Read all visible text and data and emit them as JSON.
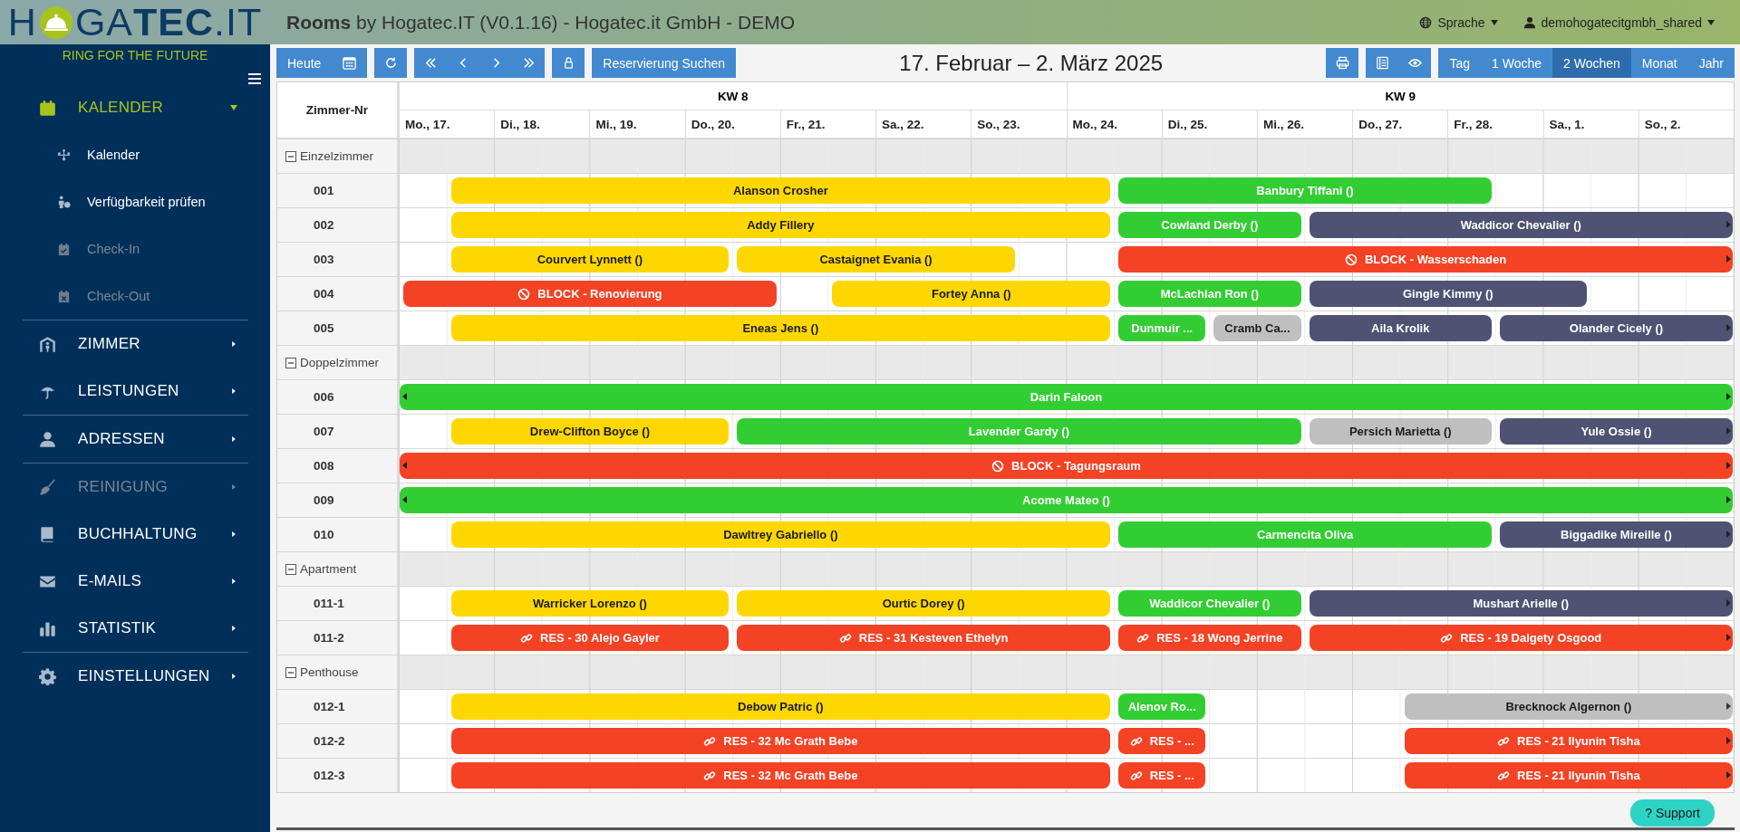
{
  "header": {
    "logo": {
      "letter": "H",
      "text": "GA**TEC**.IT"
    },
    "title": "**Rooms** by Hogatec.IT (V0.1.16) - Hogatec.it GmbH - DEMO",
    "menus": [
      {
        "label": "Sprache"
      },
      {
        "label": "demohogatecitgmbh_shared"
      }
    ]
  },
  "sidebar": {
    "tagline": "RING FOR THE FUTURE",
    "groups": [
      {
        "items": [
          {
            "label": "KALENDER",
            "selected": true,
            "expanded": true,
            "disabled": false,
            "children": [
              {
                "label": "Kalender",
                "disabled": false
              },
              {
                "label": "Verfügbarkeit prüfen",
                "disabled": false
              },
              {
                "label": "Check-In",
                "disabled": true
              },
              {
                "label": "Check-Out",
                "disabled": true
              }
            ]
          }
        ]
      },
      {
        "items": [
          {
            "label": "ZIMMER",
            "selected": false,
            "expanded": false,
            "disabled": false
          },
          {
            "label": "LEISTUNGEN",
            "selected": false,
            "expanded": false,
            "disabled": false
          }
        ]
      },
      {
        "items": [
          {
            "label": "ADRESSEN",
            "selected": false,
            "expanded": false,
            "disabled": false
          }
        ]
      },
      {
        "items": [
          {
            "label": "REINIGUNG",
            "selected": false,
            "expanded": false,
            "disabled": true
          },
          {
            "label": "BUCHHALTUNG",
            "selected": false,
            "expanded": false,
            "disabled": false
          },
          {
            "label": "E-MAILS",
            "selected": false,
            "expanded": false,
            "disabled": false
          },
          {
            "label": "STATISTIK",
            "selected": false,
            "expanded": false,
            "disabled": false
          }
        ]
      },
      {
        "items": [
          {
            "label": "EINSTELLUNGEN",
            "selected": false,
            "expanded": false,
            "disabled": false
          }
        ]
      }
    ]
  },
  "toolbar": {
    "today": "Heute",
    "search": "Reservierung Suchen",
    "range_title": "17. Februar – 2. März 2025",
    "views": [
      {
        "label": "Tag",
        "selected": false
      },
      {
        "label": "1 Woche",
        "selected": false
      },
      {
        "label": "2 Wochen",
        "selected": true
      },
      {
        "label": "Monat",
        "selected": false
      },
      {
        "label": "Jahr",
        "selected": false
      }
    ]
  },
  "grid": {
    "room_header": "Zimmer-Nr",
    "weeks": [
      {
        "label": "KW 8"
      },
      {
        "label": "KW 9"
      }
    ],
    "days": [
      {
        "label": "Mo., 17."
      },
      {
        "label": "Di., 18."
      },
      {
        "label": "Mi., 19."
      },
      {
        "label": "Do., 20."
      },
      {
        "label": "Fr., 21."
      },
      {
        "label": "Sa., 22."
      },
      {
        "label": "So., 23."
      },
      {
        "label": "Mo., 24."
      },
      {
        "label": "Di., 25."
      },
      {
        "label": "Mi., 26."
      },
      {
        "label": "Do., 27."
      },
      {
        "label": "Fr., 28."
      },
      {
        "label": "Sa., 1."
      },
      {
        "label": "So., 2."
      }
    ],
    "groups": [
      {
        "name": "Einzelzimmer",
        "expanded": true,
        "rooms": [
          {
            "number": "001",
            "bookings": [
              {
                "label": "Alanson Crosher",
                "kind": "guest",
                "color": "#ffd700",
                "continues_left": false,
                "continues_right": false
              },
              {
                "label": "Banbury Tiffani ()",
                "kind": "guest",
                "color": "#32cd32",
                "continues_left": false,
                "continues_right": false
              }
            ]
          },
          {
            "number": "002",
            "bookings": [
              {
                "label": "Addy Fillery",
                "kind": "guest",
                "color": "#ffd700",
                "continues_left": false,
                "continues_right": false
              },
              {
                "label": "Cowland Derby ()",
                "kind": "guest",
                "color": "#32cd32",
                "continues_left": false,
                "continues_right": false
              },
              {
                "label": "Waddicor Chevalier ()",
                "kind": "guest",
                "color": "#4f5273",
                "continues_left": false,
                "continues_right": true
              }
            ]
          },
          {
            "number": "003",
            "bookings": [
              {
                "label": "Courvert Lynnett ()",
                "kind": "guest",
                "color": "#ffd700",
                "continues_left": false,
                "continues_right": false
              },
              {
                "label": "Castaignet Evania ()",
                "kind": "guest",
                "color": "#ffd700",
                "continues_left": false,
                "continues_right": false
              },
              {
                "label": "BLOCK - Wasserschaden",
                "kind": "block",
                "color": "#f44225",
                "continues_left": false,
                "continues_right": true
              }
            ]
          },
          {
            "number": "004",
            "bookings": [
              {
                "label": "BLOCK - Renovierung",
                "kind": "block",
                "color": "#f44225",
                "continues_left": false,
                "continues_right": false
              },
              {
                "label": "Fortey Anna ()",
                "kind": "guest",
                "color": "#ffd700",
                "continues_left": false,
                "continues_right": false
              },
              {
                "label": "McLachlan Ron ()",
                "kind": "guest",
                "color": "#32cd32",
                "continues_left": false,
                "continues_right": false
              },
              {
                "label": "Gingle Kimmy ()",
                "kind": "guest",
                "color": "#4f5273",
                "continues_left": false,
                "continues_right": false
              }
            ]
          },
          {
            "number": "005",
            "bookings": [
              {
                "label": "Eneas Jens ()",
                "kind": "guest",
                "color": "#ffd700",
                "continues_left": false,
                "continues_right": false
              },
              {
                "label": "Dunmuir ...",
                "kind": "guest",
                "color": "#32cd32",
                "continues_left": false,
                "continues_right": false
              },
              {
                "label": "Cramb Ca...",
                "kind": "guest",
                "color": "#bfbfbf",
                "continues_left": false,
                "continues_right": false
              },
              {
                "label": "Aila Krolik",
                "kind": "guest",
                "color": "#4f5273",
                "continues_left": false,
                "continues_right": false
              },
              {
                "label": "Olander Cicely ()",
                "kind": "guest",
                "color": "#4f5273",
                "continues_left": false,
                "continues_right": true
              }
            ]
          }
        ]
      },
      {
        "name": "Doppelzimmer",
        "expanded": true,
        "rooms": [
          {
            "number": "006",
            "bookings": [
              {
                "label": "Darin Faloon",
                "kind": "guest",
                "color": "#32cd32",
                "continues_left": true,
                "continues_right": true
              }
            ]
          },
          {
            "number": "007",
            "bookings": [
              {
                "label": "Drew-Clifton Boyce ()",
                "kind": "guest",
                "color": "#ffd700",
                "continues_left": false,
                "continues_right": false
              },
              {
                "label": "Lavender Gardy ()",
                "kind": "guest",
                "color": "#32cd32",
                "continues_left": false,
                "continues_right": false
              },
              {
                "label": "Persich Marietta ()",
                "kind": "guest",
                "color": "#bfbfbf",
                "continues_left": false,
                "continues_right": false
              },
              {
                "label": "Yule Ossie ()",
                "kind": "guest",
                "color": "#4f5273",
                "continues_left": false,
                "continues_right": true
              }
            ]
          },
          {
            "number": "008",
            "bookings": [
              {
                "label": "BLOCK - Tagungsraum",
                "kind": "block",
                "color": "#f44225",
                "continues_left": true,
                "continues_right": true
              }
            ]
          },
          {
            "number": "009",
            "bookings": [
              {
                "label": "Acome Mateo ()",
                "kind": "guest",
                "color": "#32cd32",
                "continues_left": true,
                "continues_right": true
              }
            ]
          },
          {
            "number": "010",
            "bookings": [
              {
                "label": "Dawltrey Gabriello ()",
                "kind": "guest",
                "color": "#ffd700",
                "continues_left": false,
                "continues_right": false
              },
              {
                "label": "Carmencita Oliva",
                "kind": "guest",
                "color": "#32cd32",
                "continues_left": false,
                "continues_right": false
              },
              {
                "label": "Biggadike Mireille ()",
                "kind": "guest",
                "color": "#4f5273",
                "continues_left": false,
                "continues_right": true
              }
            ]
          }
        ]
      },
      {
        "name": "Apartment",
        "expanded": true,
        "rooms": [
          {
            "number": "011-1",
            "bookings": [
              {
                "label": "Warricker Lorenzo ()",
                "kind": "guest",
                "color": "#ffd700",
                "continues_left": false,
                "continues_right": false
              },
              {
                "label": "Ourtic Dorey ()",
                "kind": "guest",
                "color": "#ffd700",
                "continues_left": false,
                "continues_right": false
              },
              {
                "label": "Waddicor Chevalier ()",
                "kind": "guest",
                "color": "#32cd32",
                "continues_left": false,
                "continues_right": false
              },
              {
                "label": "Mushart Arielle ()",
                "kind": "guest",
                "color": "#4f5273",
                "continues_left": false,
                "continues_right": true
              }
            ]
          },
          {
            "number": "011-2",
            "bookings": [
              {
                "label": "RES - 30 Alejo Gayler",
                "kind": "res",
                "color": "#f44225",
                "continues_left": false,
                "continues_right": false
              },
              {
                "label": "RES - 31 Kesteven Ethelyn",
                "kind": "res",
                "color": "#f44225",
                "continues_left": false,
                "continues_right": false
              },
              {
                "label": "RES - 18 Wong Jerrine",
                "kind": "res",
                "color": "#f44225",
                "continues_left": false,
                "continues_right": false
              },
              {
                "label": "RES - 19 Dalgety Osgood",
                "kind": "res",
                "color": "#f44225",
                "continues_left": false,
                "continues_right": true
              }
            ]
          }
        ]
      },
      {
        "name": "Penthouse",
        "expanded": true,
        "rooms": [
          {
            "number": "012-1",
            "bookings": [
              {
                "label": "Debow Patric ()",
                "kind": "guest",
                "color": "#ffd700",
                "continues_left": false,
                "continues_right": false
              },
              {
                "label": "Alenov Ro...",
                "kind": "guest",
                "color": "#32cd32",
                "continues_left": false,
                "continues_right": false
              },
              {
                "label": "Brecknock Algernon ()",
                "kind": "guest",
                "color": "#bfbfbf",
                "continues_left": false,
                "continues_right": true
              }
            ]
          },
          {
            "number": "012-2",
            "bookings": [
              {
                "label": "RES - 32 Mc Grath Bebe",
                "kind": "res",
                "color": "#f44225",
                "continues_left": false,
                "continues_right": false
              },
              {
                "label": "RES - ...",
                "kind": "res",
                "color": "#f44225",
                "continues_left": false,
                "continues_right": false
              },
              {
                "label": "RES - 21 Ilyunin Tisha",
                "kind": "res",
                "color": "#f44225",
                "continues_left": false,
                "continues_right": true
              }
            ]
          },
          {
            "number": "012-3",
            "bookings": [
              {
                "label": "RES - 32 Mc Grath Bebe",
                "kind": "res",
                "color": "#f44225",
                "continues_left": false,
                "continues_right": false
              },
              {
                "label": "RES - ...",
                "kind": "res",
                "color": "#f44225",
                "continues_left": false,
                "continues_right": false
              },
              {
                "label": "RES - 21 Ilyunin Tisha",
                "kind": "res",
                "color": "#f44225",
                "continues_left": false,
                "continues_right": true
              }
            ]
          }
        ]
      }
    ]
  },
  "support": {
    "label": "? Support"
  }
}
